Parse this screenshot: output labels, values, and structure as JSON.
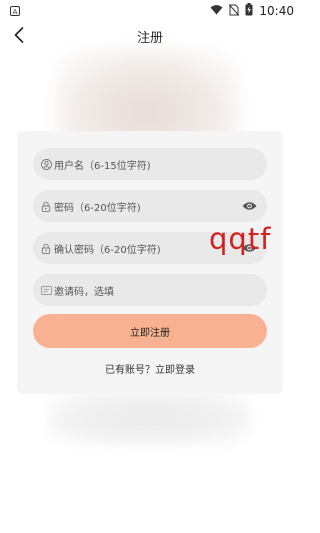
{
  "status_bar": {
    "time": "10:40",
    "icons": [
      "notification-a-icon",
      "wifi-icon",
      "no-sim-icon",
      "battery-charging-icon"
    ]
  },
  "header": {
    "title": "注册",
    "back_icon": "chevron-left-icon"
  },
  "form": {
    "username": {
      "placeholder": "用户名（6-15位字符)",
      "icon": "user-icon"
    },
    "password": {
      "placeholder": "密码（6-20位字符)",
      "icon": "lock-icon",
      "toggle_icon": "eye-icon"
    },
    "confirm_password": {
      "placeholder": "确认密码（6-20位字符)",
      "icon": "lock-icon",
      "toggle_icon": "eye-icon"
    },
    "invite_code": {
      "placeholder": "邀请码，选填",
      "icon": "ticket-icon"
    },
    "submit_label": "立即注册",
    "login_link": "已有账号？立即登录"
  },
  "annotation": {
    "text": "qqtf",
    "color": "#d32020"
  },
  "colors": {
    "accent": "#f8b291",
    "card": "#f5f5f5",
    "field": "#e9e9e9"
  }
}
